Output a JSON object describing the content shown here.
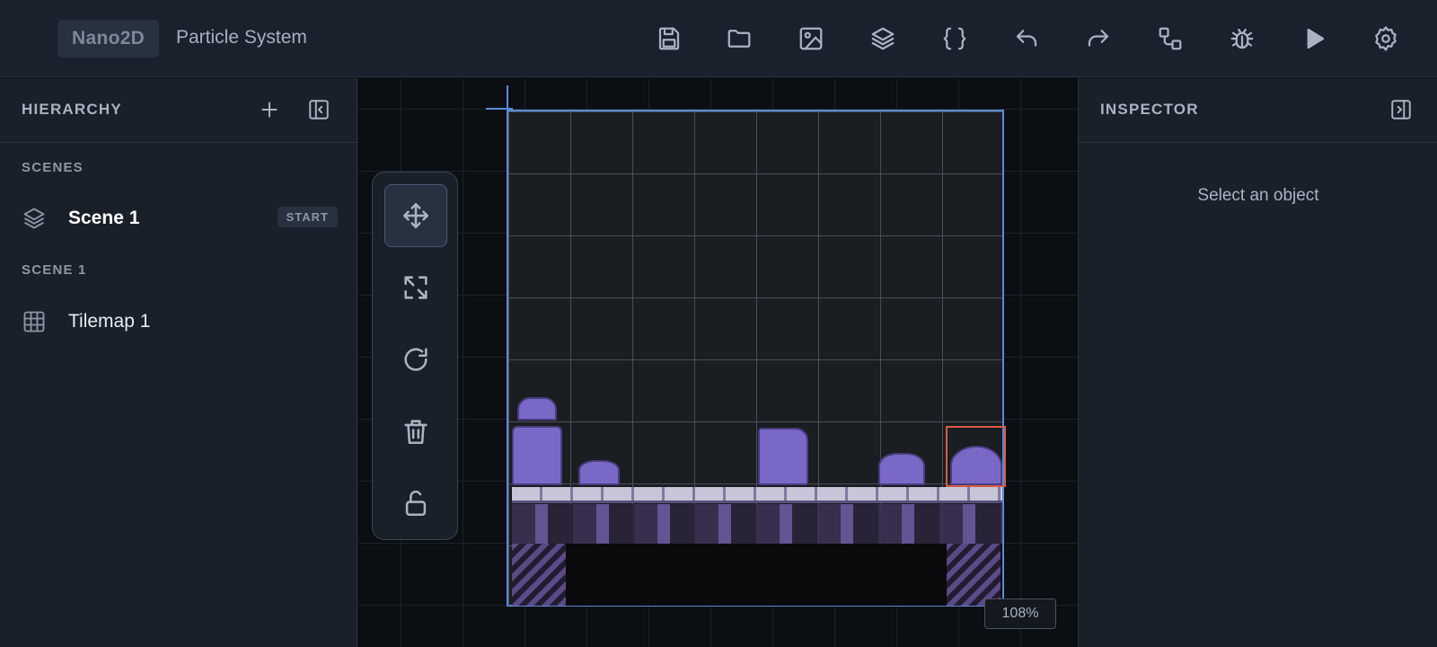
{
  "header": {
    "brand": "Nano2D",
    "project_name": "Particle System",
    "toolbar": [
      {
        "name": "save-icon",
        "label": "Save"
      },
      {
        "name": "folder-icon",
        "label": "Open"
      },
      {
        "name": "image-icon",
        "label": "Assets"
      },
      {
        "name": "layers-icon",
        "label": "Layers"
      },
      {
        "name": "code-braces-icon",
        "label": "Script"
      },
      {
        "name": "undo-icon",
        "label": "Undo"
      },
      {
        "name": "redo-icon",
        "label": "Redo"
      },
      {
        "name": "nodes-icon",
        "label": "Graph"
      },
      {
        "name": "bug-icon",
        "label": "Debug"
      },
      {
        "name": "play-icon",
        "label": "Play"
      },
      {
        "name": "gear-icon",
        "label": "Settings"
      }
    ]
  },
  "hierarchy": {
    "title": "HIERARCHY",
    "scenes_section": "SCENES",
    "scene_item": {
      "label": "Scene 1",
      "badge": "START",
      "icon": "layers-icon"
    },
    "scene_section": "SCENE 1",
    "objects": [
      {
        "label": "Tilemap 1",
        "icon": "grid-icon"
      }
    ]
  },
  "viewport": {
    "zoom": "108%",
    "tools": [
      "move-icon",
      "scale-icon",
      "rotate-icon",
      "trash-icon",
      "unlock-icon"
    ],
    "active_tool": "move-icon"
  },
  "inspector": {
    "title": "INSPECTOR",
    "empty_message": "Select an object"
  },
  "colors": {
    "accent": "#5b8bd9",
    "selection": "#d65b46",
    "sprite": "#7a68c7"
  }
}
